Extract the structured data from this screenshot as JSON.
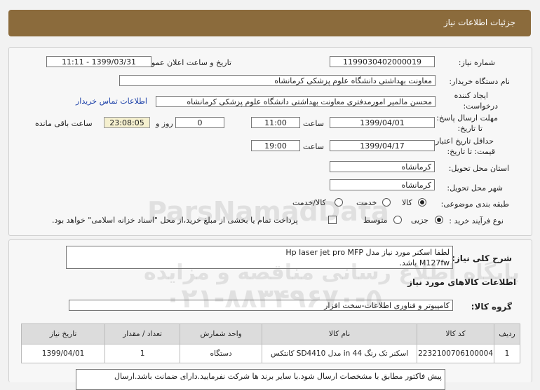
{
  "header": {
    "title": "جزئیات اطلاعات نیاز"
  },
  "form": {
    "need_number_label": "شماره نیاز:",
    "need_number": "1199030402000019",
    "announce_label": "تاریخ و ساعت اعلان عمومی:",
    "announce_value": "1399/03/31 - 11:11",
    "buyer_org_label": "نام دستگاه خریدار:",
    "buyer_org": "معاونت بهداشتی دانشگاه علوم پزشکی کرمانشاه",
    "creator_label_1": "ایجاد کننده",
    "creator_label_2": "درخواست:",
    "creator": "محسن مالمیر امورمدفتری معاونت بهداشتی دانشگاه علوم پزشکی کرمانشاه",
    "contact_link": "اطلاعات تماس خریدار",
    "deadline_label_1": "مهلت ارسال پاسخ:",
    "deadline_label_2": "تا تاریخ:",
    "deadline_date": "1399/04/01",
    "time_label": "ساعت",
    "deadline_time": "11:00",
    "days_value": "0",
    "days_label": "روز و",
    "timer": "23:08:05",
    "remaining_label": "ساعت باقی مانده",
    "validity_label_1": "حداقل تاریخ اعتبار",
    "validity_label_2": "قیمت: تا تاریخ:",
    "validity_date": "1399/04/17",
    "validity_time_label": "ساعت",
    "validity_time": "19:00",
    "province_label": "استان محل تحویل:",
    "province": "کرمانشاه",
    "city_label": "شهر محل تحویل:",
    "city": "کرمانشاه",
    "category_label": "طبقه بندی موضوعی:",
    "category_options": [
      "کالا",
      "خدمت",
      "کالا/خدمت"
    ],
    "process_label": "نوع فرآیند خرید :",
    "process_options": [
      "جزیی",
      "متوسط"
    ],
    "payment_text": "پرداخت تمام یا بخشی از مبلغ خرید،از محل \"اسناد خزانه اسلامی\" خواهد بود."
  },
  "description": {
    "label": "شرح کلی نیاز:",
    "line1": "لطفا اسکنر مورد نیاز مدل Hp laser jet pro MFP",
    "line2": "M127fw باشد."
  },
  "goods": {
    "section_title": "اطلاعات کالاهای مورد نیاز",
    "group_label": "گروه کالا:",
    "group_value": "کامپیوتر و فناوری اطلاعات-سخت افزار",
    "columns": [
      "ردیف",
      "کد کالا",
      "نام کالا",
      "واحد شمارش",
      "تعداد / مقدار",
      "تاریخ نیاز"
    ],
    "rows": [
      [
        "1",
        "2232100706100004",
        "اسکنر تک رنگ 44 in مدل SD4410 کانتکس",
        "دستگاه",
        "1",
        "1399/04/01"
      ]
    ]
  },
  "notes": {
    "text": "پیش فاکتور مطابق با مشخصات ارسال شود.با سایر برند ها شرکت نفرمایید.دارای ضمانت باشد.ارسال"
  },
  "watermark": {
    "brand": "ParsNamadData",
    "line1": "پایگاه اطلاع رسانی مناقصه و مزایده",
    "phone": "۰۲۱-۸۸۳۴۹۶۷۰-۵"
  }
}
